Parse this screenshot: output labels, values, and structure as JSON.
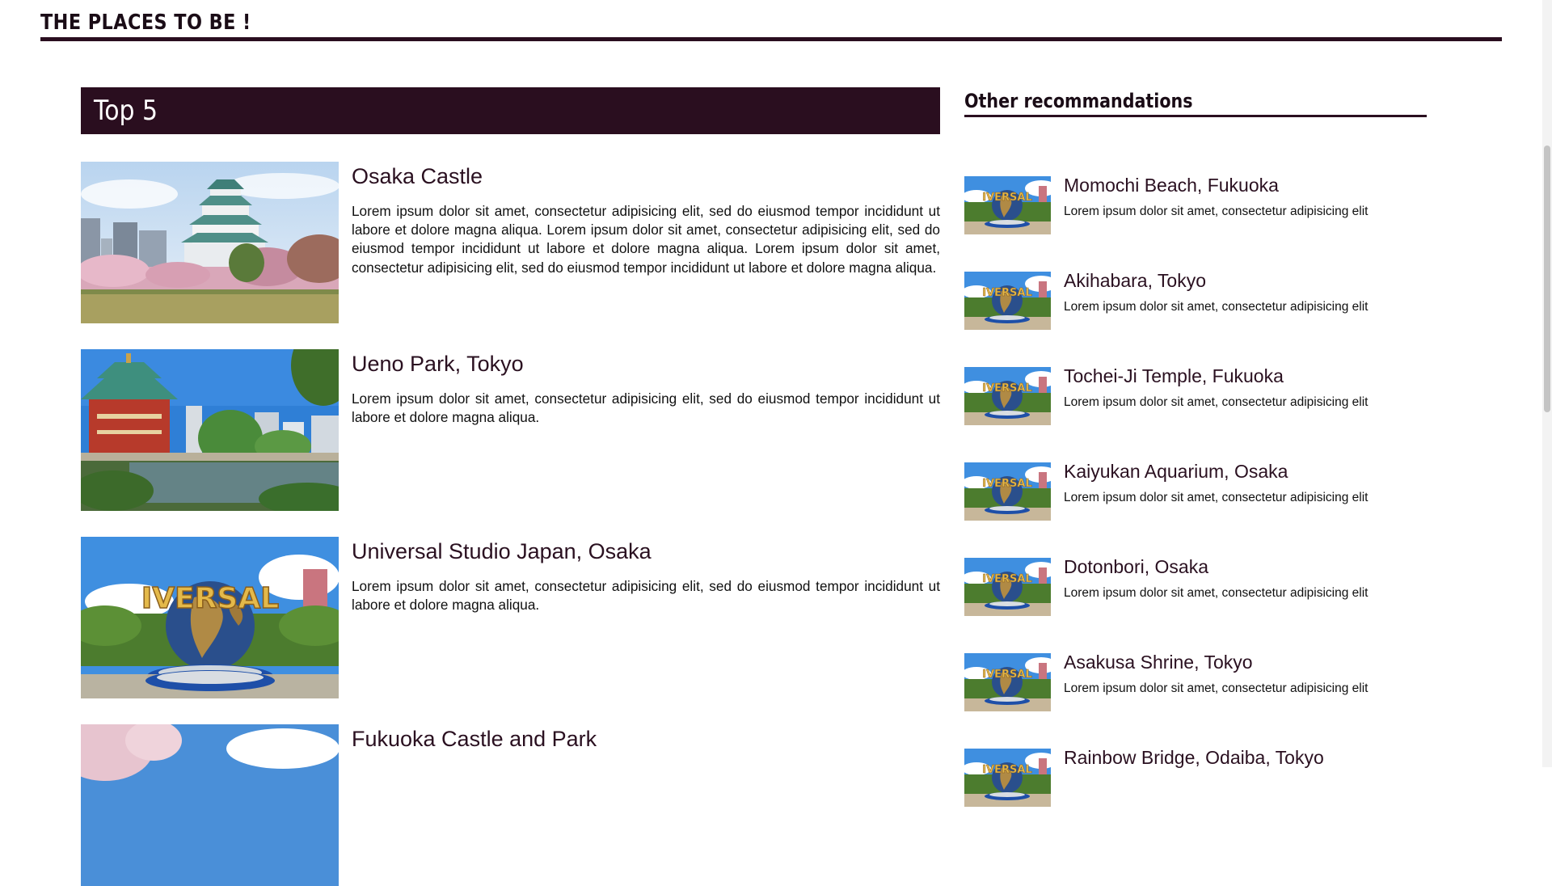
{
  "header": {
    "title": "THE PLACES TO BE !"
  },
  "top5": {
    "heading": "Top 5",
    "items": [
      {
        "title": "Osaka Castle",
        "description": "Lorem ipsum dolor sit amet, consectetur adipisicing elit, sed do eiusmod tempor incididunt ut labore et dolore magna aliqua. Lorem ipsum dolor sit amet, consectetur adipisicing elit, sed do eiusmod tempor incididunt ut labore et dolore magna aliqua. Lorem ipsum dolor sit amet, consectetur adipisicing elit, sed do eiusmod tempor incididunt ut labore et dolore magna aliqua.",
        "image": "osaka-castle-photo"
      },
      {
        "title": "Ueno Park, Tokyo",
        "description": "Lorem ipsum dolor sit amet, consectetur adipisicing elit, sed do eiusmod tempor incididunt ut labore et dolore magna aliqua.",
        "image": "ueno-park-photo"
      },
      {
        "title": "Universal Studio Japan, Osaka",
        "description": "Lorem ipsum dolor sit amet, consectetur adipisicing elit, sed do eiusmod tempor incididunt ut labore et dolore magna aliqua.",
        "image": "universal-globe-photo"
      },
      {
        "title": "Fukuoka Castle and Park",
        "description": "",
        "image": "fukuoka-castle-photo"
      }
    ]
  },
  "recommendations": {
    "heading": "Other recommandations",
    "items": [
      {
        "name": "Momochi Beach, Fukuoka",
        "description": "Lorem ipsum dolor sit amet, consectetur adipisicing elit"
      },
      {
        "name": "Akihabara, Tokyo",
        "description": "Lorem ipsum dolor sit amet, consectetur adipisicing elit"
      },
      {
        "name": "Tochei-Ji Temple, Fukuoka",
        "description": "Lorem ipsum dolor sit amet, consectetur adipisicing elit"
      },
      {
        "name": "Kaiyukan Aquarium, Osaka",
        "description": "Lorem ipsum dolor sit amet, consectetur adipisicing elit"
      },
      {
        "name": "Dotonbori, Osaka",
        "description": "Lorem ipsum dolor sit amet, consectetur adipisicing elit"
      },
      {
        "name": "Asakusa Shrine, Tokyo",
        "description": "Lorem ipsum dolor sit amet, consectetur adipisicing elit"
      },
      {
        "name": "Rainbow Bridge, Odaiba, Tokyo",
        "description": ""
      }
    ],
    "thumbnail": "universal-globe-thumbnail"
  },
  "colors": {
    "brand_dark": "#2a0e1f",
    "background": "#ffffff",
    "text": "#2a1020"
  }
}
